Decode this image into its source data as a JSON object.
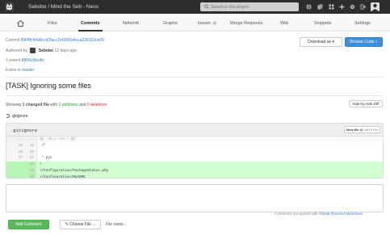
{
  "header": {
    "title": "Sebobo / Mind the Seb - Neos",
    "search_placeholder": "Search in this project"
  },
  "nav": {
    "items": [
      "Files",
      "Commits",
      "Network",
      "Graphs",
      "Issues",
      "Merge Requests",
      "Wiki",
      "Snippets",
      "Settings"
    ],
    "active": "Commits",
    "issues_count": "0"
  },
  "commit": {
    "label": "Commit",
    "sha": "89f4ffcfe6dfccd2facc1b6550a4cca228153ce09",
    "authored_by_label": "Authored by",
    "author": "Sebobo",
    "time": "12 days ago",
    "parent_label": "1 parent",
    "parent_sha": "8856c6bcdb",
    "exists_in_label": "Exists in",
    "branch": "master",
    "title": "[TASK] Ignoring some files"
  },
  "buttons": {
    "download": "Download as",
    "browse": "Browse Code »",
    "side_by_side": "Side-by-side Diff",
    "view_file": "View file @",
    "view_file_sha": "89f4ffc",
    "add_comment": "Add Comment",
    "choose_file": "Choose File ...",
    "file_name": "File name..."
  },
  "summary": {
    "showing": "Showing",
    "changed": "1 changed file",
    "with": "with",
    "additions": "3 additions",
    "and": "and",
    "deletions": "0 deletions"
  },
  "file": {
    "name": ".gitignore",
    "header_name": ".gitignore"
  },
  "diff_rows": [
    {
      "type": "hunk",
      "old": "...",
      "new": "...",
      "text": "@@ -25,4 +25,7 @@"
    },
    {
      "type": "ctx",
      "old": "25",
      "new": "25",
      "text": " /*"
    },
    {
      "type": "ctx",
      "old": "26",
      "new": "26",
      "text": " "
    },
    {
      "type": "ctx",
      "old": "27",
      "new": "27",
      "text": " *.pyc"
    },
    {
      "type": "add",
      "old": "",
      "new": "28",
      "text": "+"
    },
    {
      "type": "add",
      "old": "",
      "new": "29",
      "text": "+/Configuration/PackageStates.php"
    },
    {
      "type": "add",
      "old": "",
      "new": "30",
      "text": "+/Configuration/README"
    }
  ],
  "comment": {
    "parsed_note": "Comments are parsed with",
    "markdown_link": "GitLab Flavored Markdown"
  },
  "colors": {
    "accent": "#3d8fd8",
    "addition": "#3c9a3c",
    "deletion": "#cc3333",
    "add_button": "#5cb85c"
  }
}
